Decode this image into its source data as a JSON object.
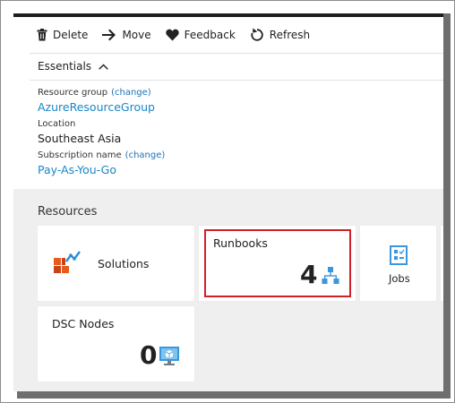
{
  "toolbar": {
    "delete_label": "Delete",
    "move_label": "Move",
    "feedback_label": "Feedback",
    "refresh_label": "Refresh"
  },
  "essentials": {
    "label": "Essentials",
    "resource_group_label": "Resource group",
    "resource_group_change": "(change)",
    "resource_group_value": "AzureResourceGroup",
    "location_label": "Location",
    "location_value": "Southeast Asia",
    "subscription_label": "Subscription name",
    "subscription_change": "(change)",
    "subscription_value": "Pay-As-You-Go"
  },
  "resources": {
    "title": "Resources",
    "solutions_label": "Solutions",
    "runbooks_label": "Runbooks",
    "runbooks_count": "4",
    "jobs_label": "Jobs",
    "dsc_label": "DSC Nodes",
    "dsc_count": "0"
  },
  "colors": {
    "link": "#1a86c8",
    "highlight": "#d0202a",
    "tile_background": "#efefef"
  },
  "icons": [
    "trash-icon",
    "arrow-right-icon",
    "heart-icon",
    "refresh-icon",
    "chevron-up-icon",
    "solutions-icon",
    "runbook-hierarchy-icon",
    "jobs-icon",
    "dsc-node-icon"
  ]
}
